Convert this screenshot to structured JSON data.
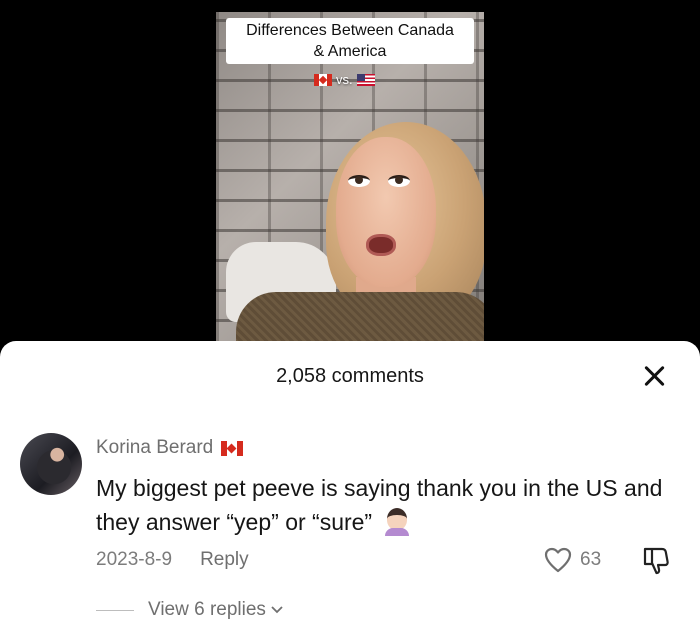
{
  "video": {
    "caption_line1": "Differences Between Canada",
    "caption_line2": "& America",
    "vs_text": "vs."
  },
  "comments_sheet": {
    "title": "2,058 comments",
    "comment": {
      "author": "Korina Berard",
      "text": "My biggest pet peeve is saying thank you in the US and they answer “yep” or “sure”",
      "date": "2023-8-9",
      "reply_label": "Reply",
      "like_count": "63",
      "view_replies_label": "View 6 replies"
    }
  },
  "icons": [
    "canada-flag-icon",
    "us-flag-icon",
    "close-icon",
    "heart-icon",
    "dislike-icon",
    "chevron-down-icon",
    "woman-facepalming-icon"
  ]
}
